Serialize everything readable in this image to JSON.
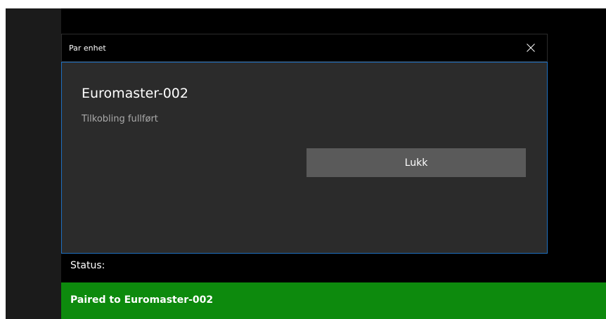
{
  "dialog": {
    "title": "Par enhet",
    "device_name": "Euromaster-002",
    "connection_status": "Tilkobling fullført",
    "close_button_label": "Lukk",
    "close_icon": "close-icon",
    "accent_color": "#1f6fbf"
  },
  "status": {
    "label": "Status:",
    "message": "Paired to Euromaster-002",
    "bar_color": "#0d8a0d"
  }
}
